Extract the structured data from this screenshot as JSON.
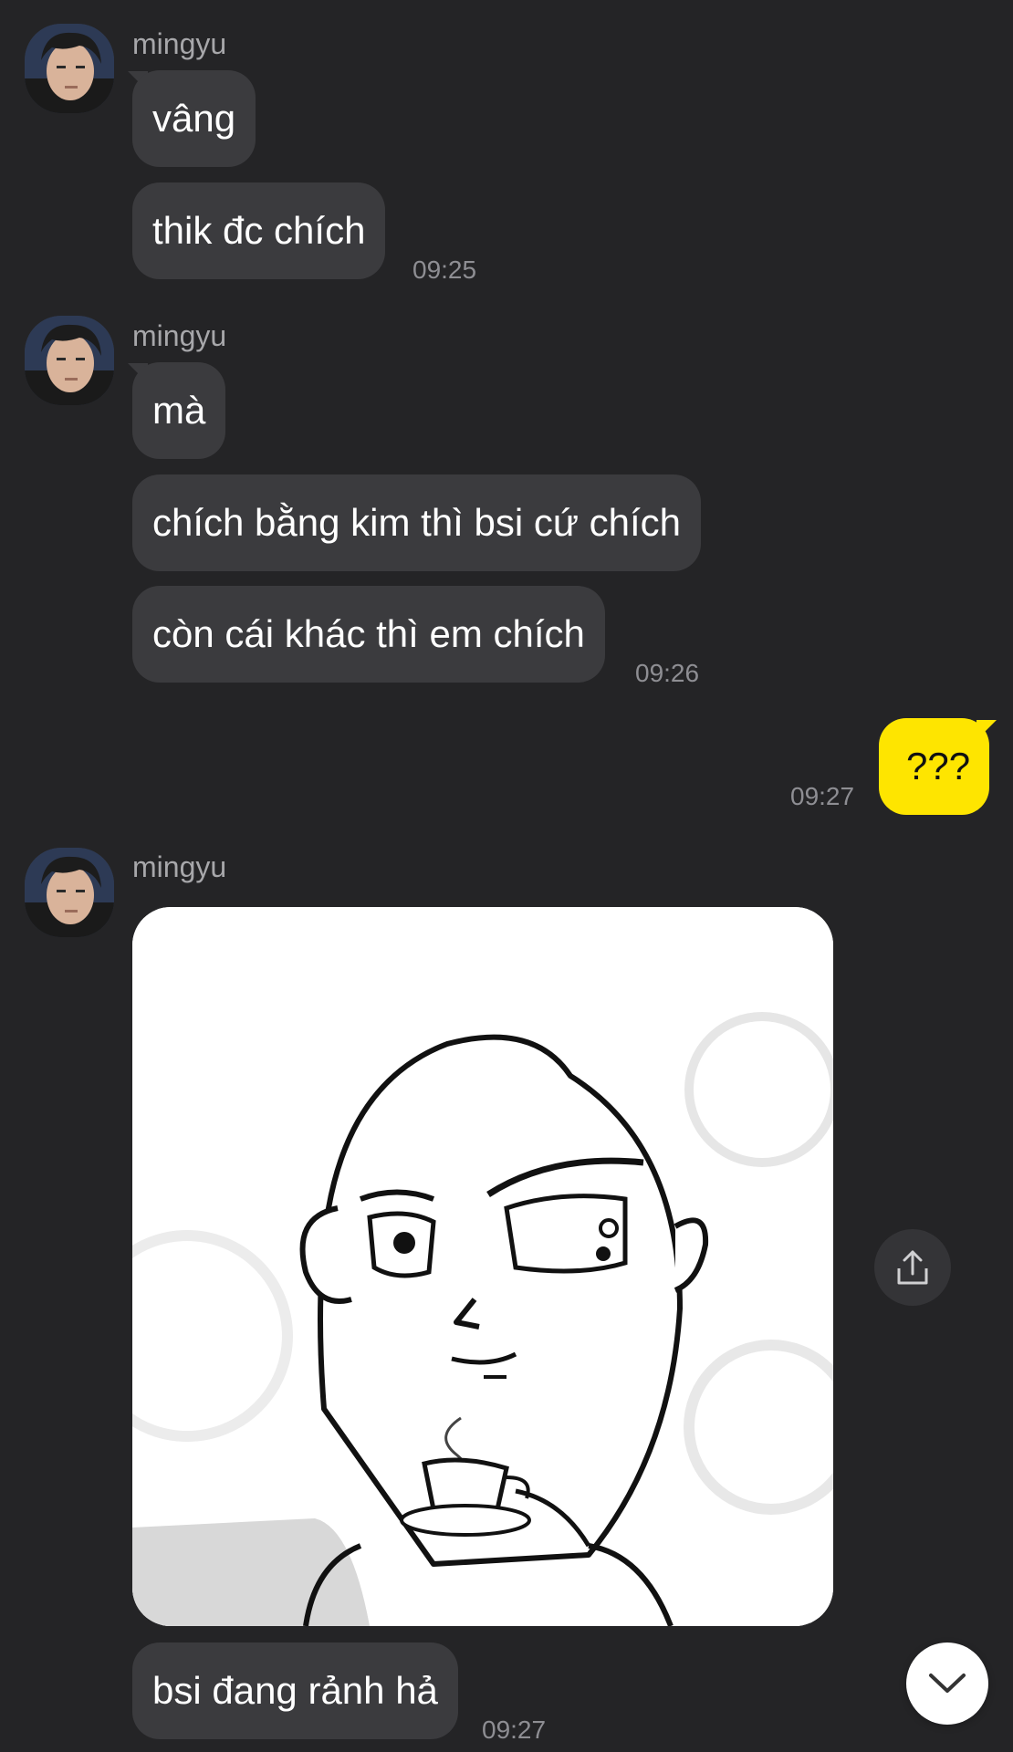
{
  "groups": [
    {
      "sender": "mingyu",
      "messages": [
        "vâng",
        "thik đc chích"
      ],
      "time": "09:25"
    },
    {
      "sender": "mingyu",
      "messages": [
        "mà",
        "chích bằng kim thì bsi cứ chích",
        "còn cái khác thì em chích"
      ],
      "time": "09:26"
    },
    {
      "sender": "mingyu",
      "messages": [
        "bsi đang rảnh hả"
      ],
      "time": "09:27"
    }
  ],
  "my_message": {
    "text": "???",
    "time": "09:27"
  },
  "icons": {
    "share": "share-icon",
    "scroll_down": "chevron-down-icon",
    "avatar": "avatar-photo"
  },
  "colors": {
    "background": "#242426",
    "incoming_bubble": "#3b3b3e",
    "outgoing_bubble": "#fee500"
  }
}
